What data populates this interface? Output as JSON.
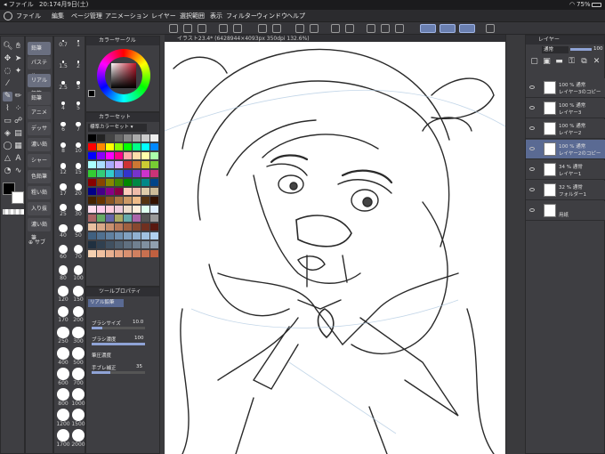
{
  "status": {
    "left": "◂ ファイル",
    "time": "20:17",
    "date": "4月9日(土)",
    "battery": "75%"
  },
  "menu": [
    "ファイル",
    "編集",
    "ページ管理",
    "アニメーション",
    "レイヤー",
    "選択範囲",
    "表示",
    "フィルター",
    "ウィンドウ",
    "ヘルプ"
  ],
  "document_tab": "イラスト23.4* (6428944×4093px 350dpi 132.6%)",
  "color_circle_title": "カラーサークル",
  "color_set": {
    "title": "カラーセット",
    "set_name": "標準カラーセット"
  },
  "subtools": [
    "鉛筆",
    "パステル",
    "リアル鉛筆",
    "鉛筆",
    "アニメー",
    "デッサン",
    "濃い鉛筆",
    "シャーペン",
    "色鉛筆",
    "粗い鉛筆",
    "入り抜き",
    "濃い鉛筆"
  ],
  "subtool_footer": "サブ",
  "brush_sizes": [
    "0.7",
    "1",
    "1.5",
    "2",
    "2.5",
    "3",
    "4",
    "5",
    "6",
    "7",
    "8",
    "10",
    "12",
    "15",
    "17",
    "20",
    "25",
    "30",
    "40",
    "50",
    "60",
    "70",
    "80",
    "100",
    "120",
    "150",
    "170",
    "200",
    "250",
    "300",
    "400",
    "500",
    "600",
    "700",
    "800",
    "1000",
    "1200",
    "1500",
    "1700",
    "2000"
  ],
  "tool_property": {
    "title": "ツールプロパティ",
    "tool_name": "リアル鉛筆",
    "brush_size_label": "ブラシサイズ",
    "brush_size": "10.0",
    "brush_density_label": "ブラシ濃度",
    "brush_density": "100",
    "stroke_label": "筆圧濃度",
    "stabilization_label": "手ブレ補正",
    "stabilization": "35"
  },
  "layer_panel": {
    "title": "レイヤー",
    "blend_mode": "通常",
    "opacity": "100",
    "layers": [
      {
        "opacity": "100 %",
        "mode": "通常",
        "name": "レイヤー3のコピー",
        "selected": false
      },
      {
        "opacity": "100 %",
        "mode": "通常",
        "name": "レイヤー3",
        "selected": false
      },
      {
        "opacity": "100 %",
        "mode": "通常",
        "name": "レイヤー2",
        "selected": false
      },
      {
        "opacity": "100 %",
        "mode": "通常",
        "name": "レイヤー2のコピー",
        "selected": true
      },
      {
        "opacity": "34 %",
        "mode": "通常",
        "name": "レイヤー1",
        "selected": false
      },
      {
        "opacity": "32 %",
        "mode": "通常",
        "name": "フォルダー1",
        "selected": false
      },
      {
        "opacity": "",
        "mode": "",
        "name": "用紙",
        "selected": false
      }
    ]
  },
  "colors": {
    "accent": "#5a6a93",
    "panel": "#3e3e42",
    "canvas": "#ffffff",
    "main_color": "#000000",
    "sub_color": "#ffffff"
  }
}
